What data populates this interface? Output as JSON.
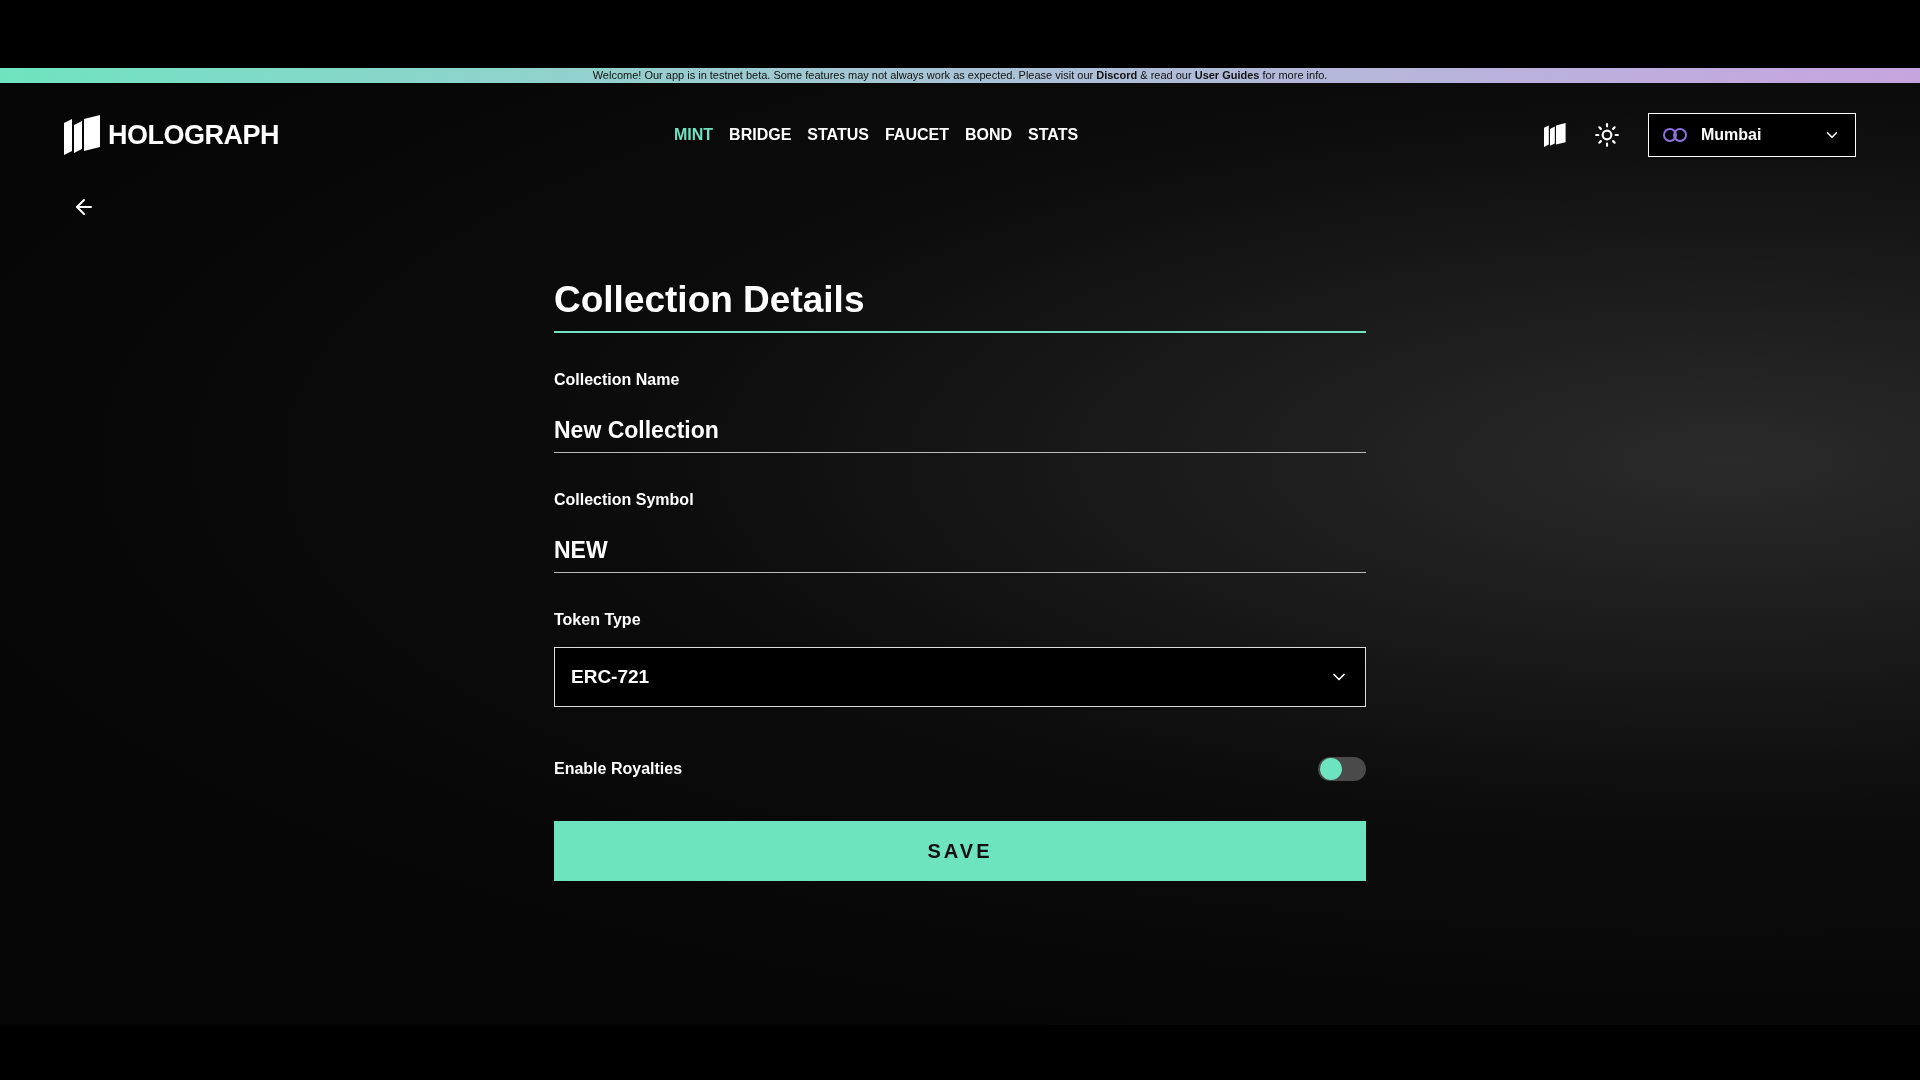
{
  "banner": {
    "text": "Welcome! Our app is in testnet beta. Some features may not always work as expected. Please visit our **Discord** & read our **User Guides** for more info."
  },
  "brand": {
    "name": "HOLOGRAPH"
  },
  "nav": [
    {
      "label": "MINT",
      "selected": true
    },
    {
      "label": "BRIDGE",
      "selected": false
    },
    {
      "label": "STATUS",
      "selected": false
    },
    {
      "label": "FAUCET",
      "selected": false
    },
    {
      "label": "BOND",
      "selected": false
    },
    {
      "label": "STATS",
      "selected": false
    }
  ],
  "network": {
    "value": "Mumbai"
  },
  "form": {
    "title": "Collection Details",
    "fields": [
      {
        "kind": "text",
        "label": "Collection Name",
        "value": "New Collection"
      },
      {
        "kind": "text",
        "label": "Collection Symbol",
        "value": "NEW"
      },
      {
        "kind": "select",
        "label": "Token Type",
        "value": "ERC-721"
      },
      {
        "kind": "toggle",
        "label": "Enable Royalties",
        "on": false
      }
    ],
    "submit": "SAVE"
  }
}
